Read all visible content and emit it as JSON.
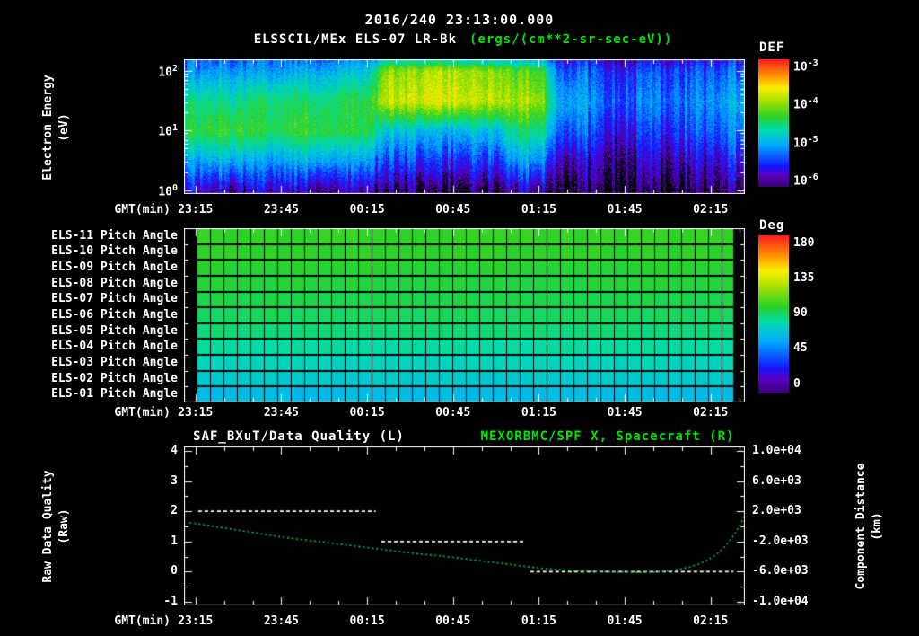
{
  "style": {
    "background": "#000000",
    "text_color": "#ffffff",
    "accent_green": "#00e600",
    "curve_green": "#00c840",
    "frame_color": "#ffffff"
  },
  "header": {
    "datetime": "2016/240 23:13:00.000"
  },
  "time_axis": {
    "label": "GMT(min)",
    "start": "23:11",
    "end": "02:27",
    "major_ticks": [
      "23:15",
      "23:45",
      "00:15",
      "00:45",
      "01:15",
      "01:45",
      "02:15"
    ]
  },
  "panel1": {
    "title": "ELSSCIL/MEx ELS-07 LR-Bk",
    "units": "(ergs/(cm**2-sr-sec-eV))",
    "ylabel_line1": "Electron Energy",
    "ylabel_line2": "(eV)",
    "y_log_range": [
      -0.06,
      2.19
    ],
    "y_ticks": [
      {
        "base": "10",
        "exp": "2",
        "log": 2
      },
      {
        "base": "10",
        "exp": "1",
        "log": 1
      },
      {
        "base": "10",
        "exp": "0",
        "log": 0
      }
    ],
    "colorbar": {
      "label": "DEF",
      "log_range": [
        -6.18,
        -2.84
      ],
      "ticks": [
        {
          "base": "10",
          "exp": "-3",
          "log": -3
        },
        {
          "base": "10",
          "exp": "-4",
          "log": -4
        },
        {
          "base": "10",
          "exp": "-5",
          "log": -5
        },
        {
          "base": "10",
          "exp": "-6",
          "log": -6
        }
      ]
    }
  },
  "panel2": {
    "rows": [
      "ELS-11 Pitch Angle",
      "ELS-10 Pitch Angle",
      "ELS-09 Pitch Angle",
      "ELS-08 Pitch Angle",
      "ELS-07 Pitch Angle",
      "ELS-06 Pitch Angle",
      "ELS-05 Pitch Angle",
      "ELS-04 Pitch Angle",
      "ELS-03 Pitch Angle",
      "ELS-02 Pitch Angle",
      "ELS-01 Pitch Angle"
    ],
    "colorbar": {
      "label": "Deg",
      "range": [
        -12,
        190
      ],
      "ticks": [
        180,
        135,
        90,
        45,
        0
      ]
    }
  },
  "panel3": {
    "title_left": "SAF_BXuT/Data Quality (L)",
    "title_right": "MEXORBMC/SPF X, Spacecraft (R)",
    "ylabel_left_line1": "Raw Data Quality",
    "ylabel_left_line2": "(Raw)",
    "ylabel_right_line1": "Component Distance",
    "ylabel_right_line2": "(km)",
    "y_left": {
      "range": [
        -1,
        4
      ],
      "ticks": [
        4,
        3,
        2,
        1,
        0,
        -1
      ]
    },
    "y_right": {
      "range": [
        -10000,
        10000
      ],
      "ticks": [
        "1.0e+04",
        "6.0e+03",
        "2.0e+03",
        "-2.0e+03",
        "-6.0e+03",
        "-1.0e+04"
      ]
    }
  },
  "chart_data": [
    {
      "type": "heatmap",
      "name": "electron_energy_spectrogram",
      "title": "ELSSCIL/MEx ELS-07 LR-Bk",
      "units": "ergs/(cm**2-sr-sec-eV)",
      "x_start": "23:11",
      "x_end": "02:27",
      "times_min": [
        0,
        15,
        30,
        45,
        60,
        75,
        90,
        105,
        120,
        135,
        150,
        165,
        180,
        195
      ],
      "log10_energy": [
        0,
        0.5,
        1.0,
        1.5,
        2.0,
        2.2
      ],
      "log10_def": [
        [
          -5.8,
          -5.1,
          -4.4,
          -4.6,
          -5.2,
          -5.4
        ],
        [
          -5.9,
          -5.0,
          -4.3,
          -4.6,
          -5.1,
          -5.4
        ],
        [
          -5.8,
          -5.1,
          -4.4,
          -4.5,
          -5.1,
          -5.3
        ],
        [
          -5.9,
          -5.0,
          -4.3,
          -4.5,
          -5.0,
          -5.3
        ],
        [
          -5.9,
          -5.1,
          -4.4,
          -4.4,
          -4.9,
          -5.2
        ],
        [
          -6.1,
          -5.5,
          -4.9,
          -3.8,
          -4.0,
          -4.9
        ],
        [
          -6.2,
          -5.6,
          -5.0,
          -3.7,
          -3.9,
          -4.8
        ],
        [
          -6.1,
          -5.5,
          -4.9,
          -3.8,
          -4.0,
          -4.9
        ],
        [
          -5.9,
          -5.1,
          -4.5,
          -3.9,
          -4.2,
          -5.0
        ],
        [
          -6.1,
          -5.8,
          -5.3,
          -5.0,
          -5.3,
          -5.6
        ],
        [
          -6.2,
          -6.0,
          -5.7,
          -5.4,
          -5.6,
          -5.9
        ],
        [
          -6.2,
          -5.9,
          -5.6,
          -5.3,
          -5.5,
          -5.8
        ],
        [
          -6.1,
          -5.8,
          -5.4,
          -5.2,
          -5.4,
          -5.7
        ],
        [
          -6.0,
          -5.6,
          -5.2,
          -5.0,
          -5.3,
          -5.6
        ]
      ]
    },
    {
      "type": "heatmap",
      "name": "pitch_angles",
      "rows": [
        "ELS-11",
        "ELS-10",
        "ELS-09",
        "ELS-08",
        "ELS-07",
        "ELS-06",
        "ELS-05",
        "ELS-04",
        "ELS-03",
        "ELS-02",
        "ELS-01"
      ],
      "values_deg": [
        101,
        100,
        98,
        96,
        94,
        91,
        87,
        81,
        75,
        70,
        63
      ]
    },
    {
      "type": "line",
      "name": "data_quality_and_spacecraft_x",
      "series": [
        {
          "name": "SAF_BXuT/Data Quality",
          "axis": "L",
          "style": "dashed_white",
          "segments": [
            {
              "value": 2,
              "from": "23:16",
              "to": "00:18"
            },
            {
              "value": 1,
              "from": "00:20",
              "to": "01:10"
            },
            {
              "value": 0,
              "from": "01:12",
              "to": "02:23"
            }
          ]
        },
        {
          "name": "MEXORBMC/SPF X, Spacecraft",
          "axis": "R",
          "style": "dotted_green",
          "points": [
            [
              "23:13",
              500
            ],
            [
              "23:30",
              -500
            ],
            [
              "23:45",
              -1400
            ],
            [
              "00:00",
              -2100
            ],
            [
              "00:15",
              -2800
            ],
            [
              "00:30",
              -3500
            ],
            [
              "00:45",
              -4100
            ],
            [
              "01:00",
              -4800
            ],
            [
              "01:15",
              -5500
            ],
            [
              "01:30",
              -5900
            ],
            [
              "01:45",
              -6050
            ],
            [
              "01:55",
              -6050
            ],
            [
              "02:05",
              -5600
            ],
            [
              "02:12",
              -4800
            ],
            [
              "02:18",
              -3400
            ],
            [
              "02:23",
              -1200
            ],
            [
              "02:27",
              1400
            ]
          ]
        }
      ]
    }
  ]
}
